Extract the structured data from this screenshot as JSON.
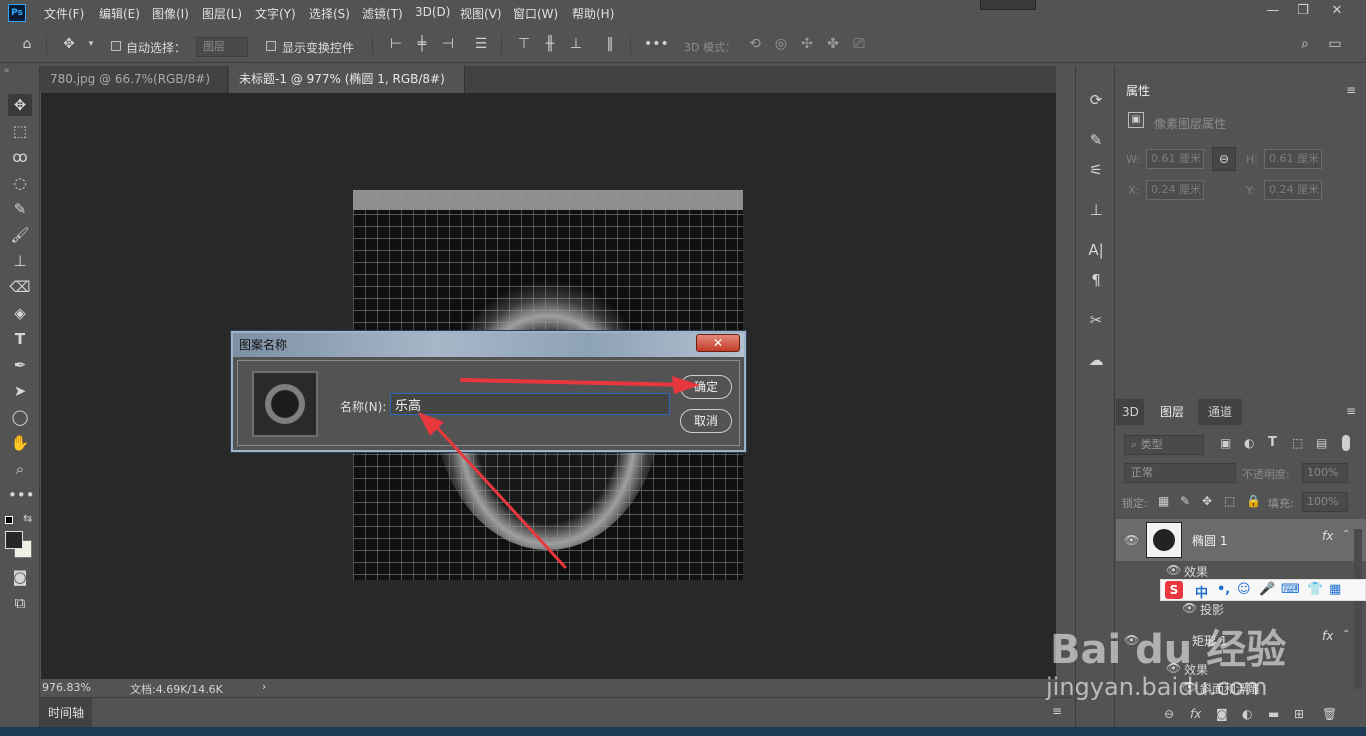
{
  "app": {
    "logo": "Ps"
  },
  "menu": [
    "文件(F)",
    "编辑(E)",
    "图像(I)",
    "图层(L)",
    "文字(Y)",
    "选择(S)",
    "滤镜(T)",
    "3D(D)",
    "视图(V)",
    "窗口(W)",
    "帮助(H)"
  ],
  "options": {
    "auto_select_label": "自动选择：",
    "auto_select_value": "图层",
    "show_transform_label": "显示变换控件",
    "mode_3d_label": "3D 模式："
  },
  "tabs": [
    {
      "label": "780.jpg @ 66.7%(RGB/8#) *",
      "close": "×"
    },
    {
      "label": "未标题-1 @ 977% (椭圆 1, RGB/8#) *",
      "close": "×"
    }
  ],
  "status": {
    "zoom": "976.83%",
    "doc": "文档:4.69K/14.6K",
    "arrow": "›"
  },
  "timeline": {
    "label": "时间轴"
  },
  "properties": {
    "tab": "属性",
    "section": "像素图层属性",
    "w_label": "W:",
    "w_value": "0.61 厘米",
    "h_label": "H:",
    "h_value": "0.61 厘米",
    "x_label": "X:",
    "x_value": "0.24 厘米",
    "y_label": "Y:",
    "y_value": "0.24 厘米"
  },
  "layers": {
    "tabs": [
      "3D",
      "图层",
      "通道"
    ],
    "filter_value": "类型",
    "blend_value": "正常",
    "opacity_label": "不透明度:",
    "opacity_value": "100%",
    "lock_label": "锁定:",
    "fill_label": "填充:",
    "fill_value": "100%",
    "items": [
      {
        "name": "椭圆 1",
        "fx": "fx",
        "effects_label": "效果",
        "effect": "投影"
      },
      {
        "name": "矩形 1",
        "fx": "fx",
        "effects_label": "效果",
        "effect": "斜面和浮雕"
      }
    ]
  },
  "dialog": {
    "title": "图案名称",
    "close": "✕",
    "name_label": "名称(N):",
    "name_value": "乐高",
    "ok": "确定",
    "cancel": "取消"
  },
  "ime": {
    "lang": "中"
  },
  "watermark": {
    "brand": "Bai du 经验",
    "url": "jingyan.baidu.com"
  },
  "colors": {
    "accent": "#e8383d",
    "dialog_border": "#9fb3c8",
    "input_border": "#2f66b5"
  }
}
